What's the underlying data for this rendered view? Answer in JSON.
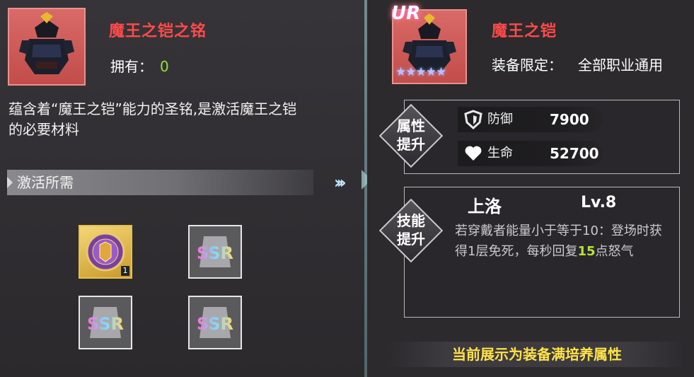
{
  "left_panel": {
    "item_name": "魔王之铠之铭",
    "owned_label": "拥有：",
    "owned_value": "0",
    "description": "蕴含着“魔王之铠”能力的圣铭,是激活魔王之铠的必要材料",
    "requirement_header": "激活所需",
    "materials": [
      {
        "type": "gold-emblem",
        "quantity": "1"
      },
      {
        "type": "SSR",
        "label": "SSR"
      },
      {
        "type": "SSR",
        "label": "SSR"
      },
      {
        "type": "SSR",
        "label": "SSR"
      }
    ]
  },
  "right_panel": {
    "rarity": "UR",
    "star_count": 5,
    "equip_name": "魔王之铠",
    "limit_label": "装备限定：",
    "limit_value": "全部职业通用",
    "attr_section_label": "属性提升",
    "stats": [
      {
        "icon": "shield-icon",
        "name": "防御",
        "value": "7900"
      },
      {
        "icon": "heart-icon",
        "name": "生命",
        "value": "52700"
      }
    ],
    "skill_section_label": "技能提升",
    "skill_name": "上洛",
    "skill_level": "Lv.8",
    "skill_desc_before": "若穿戴者能量小于等于10：登场时获得1层免死，每秒回复",
    "skill_desc_highlight": "15",
    "skill_desc_after": "点怒气",
    "footer_note": "当前展示为装备满培养属性"
  },
  "colors": {
    "title_red": "#ff4a4a",
    "owned_green": "#8ee23a",
    "highlight_green": "#b6e33a",
    "footer_yellow": "#ffe24a",
    "portrait_bg": "#d96a67"
  }
}
